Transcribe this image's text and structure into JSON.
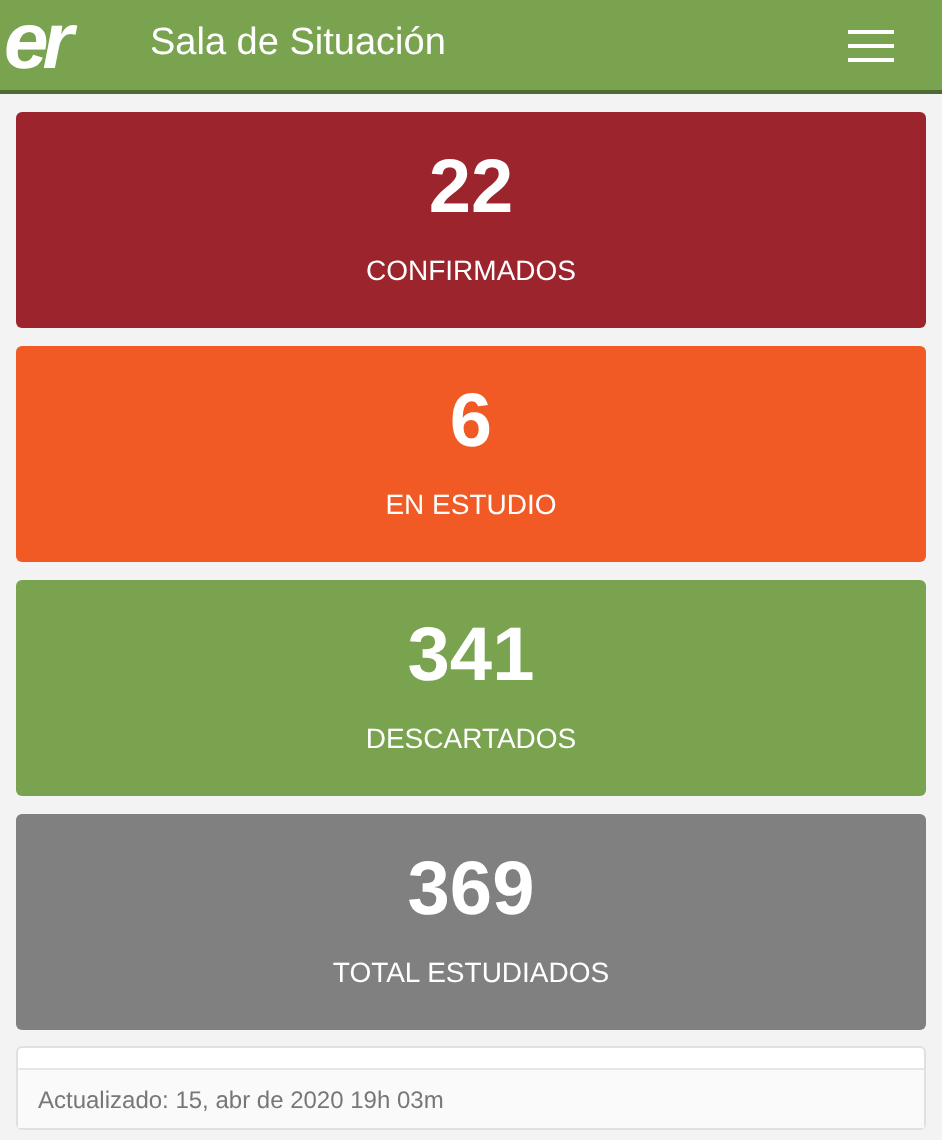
{
  "header": {
    "logo": "er",
    "title": "Sala de Situación"
  },
  "stats": [
    {
      "value": "22",
      "label": "CONFIRMADOS",
      "color": "#9b242d"
    },
    {
      "value": "6",
      "label": "EN ESTUDIO",
      "color": "#f15a24"
    },
    {
      "value": "341",
      "label": "DESCARTADOS",
      "color": "#7aa350"
    },
    {
      "value": "369",
      "label": "TOTAL ESTUDIADOS",
      "color": "#808080"
    }
  ],
  "footer": {
    "updated": "Actualizado: 15, abr de 2020 19h 03m"
  }
}
